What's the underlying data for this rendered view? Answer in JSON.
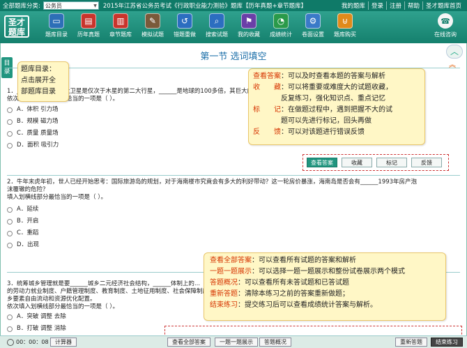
{
  "topbar": {
    "category_label": "全部题库分类:",
    "category_value": "公务员",
    "exam_title": "2015年江苏省公务员考试《行政职业能力测验》题库【历年真题+章节题库】",
    "links": [
      "我的题库",
      "登录",
      "注册",
      "帮助",
      "圣才题库首页"
    ]
  },
  "logo": {
    "line1": "圣才",
    "line2": "题库"
  },
  "tools": [
    {
      "label": "题库目录",
      "icon": "monitor-icon",
      "color": "#2d6fb7"
    },
    {
      "label": "历年真题",
      "icon": "document-icon",
      "color": "#c9342c"
    },
    {
      "label": "章节题库",
      "icon": "book-icon",
      "color": "#c9342c"
    },
    {
      "label": "模拟试题",
      "icon": "pencil-icon",
      "color": "#7a5a3a"
    },
    {
      "label": "错题重做",
      "icon": "undo-icon",
      "color": "#2c6ec0"
    },
    {
      "label": "搜索试题",
      "icon": "search-icon",
      "color": "#2c6ec0"
    },
    {
      "label": "我的收藏",
      "icon": "bookmark-icon",
      "color": "#6a3fa8"
    },
    {
      "label": "成绩统计",
      "icon": "pie-chart-icon",
      "color": "#2a9a4a"
    },
    {
      "label": "卷面设置",
      "icon": "gear-icon",
      "color": "#3a7ac8"
    },
    {
      "label": "题库购买",
      "icon": "cart-icon",
      "color": "#e08a1a"
    }
  ],
  "online": {
    "label": "在线咨询",
    "icon": "chat-icon"
  },
  "side_tab": {
    "label": "目录"
  },
  "section_title": "第一节  选词填空",
  "questions": [
    {
      "text": "1．______木星的第二大卫星是仅次于木星的第二大行星，______是地球的100多倍，其巨大的磁场...",
      "text2": "依次填入划横线部分最恰当的一项是（    ）。",
      "options": [
        "A．体积  引力场",
        "B．规模  磁力场",
        "C．质量  质量场",
        "D．面积  吸引力"
      ]
    },
    {
      "text": "2．牛年末虎年初，世人已经开始思考：国际旅游岛的规划，对于海南楼市究竟会有多大的利好带动？这一轮房价暴涨，海南岛是否会有______1993年房产泡",
      "text2": "沫覆辙的危险？",
      "text3": "填入划横线部分最恰当的一项是（    ）。",
      "options": [
        "A．延续",
        "B．开启",
        "C．重蹈",
        "D．出现"
      ]
    },
    {
      "text": "3．统筹城乡管理就是要______城乡二元经济社会结构，______体制上的...",
      "text2": "的劳动力就业制度、户籍管理制度、教育制度、土地征用制度、社会保障制度等，",
      "text3": "乡要素自由流动和资源优化配置。",
      "text4": "依次填入划横线部分最恰当的一项是（    ）。",
      "options": [
        "A．突破  调整  去除",
        "B．打破  调整  消除"
      ]
    }
  ],
  "question_actions": [
    "查看答案",
    "收藏",
    "标记",
    "反馈"
  ],
  "callout_catalog": {
    "line1": "题库目录：",
    "line2": "点击展开全",
    "line3": "部题库目录"
  },
  "callout_actions": [
    {
      "term": "查看答案",
      "desc": "：可以及时查看本题的答案与解析"
    },
    {
      "term": "收　　藏",
      "desc": "：可以将重要或难度大的试题收藏，"
    },
    {
      "term": "",
      "desc": "　　　　反复练习，强化知识点、重点记忆"
    },
    {
      "term": "标　　记",
      "desc": "：在做题过程中，遇到把握不大的试"
    },
    {
      "term": "",
      "desc": "　　　　题可以先进行标记，回头再做"
    },
    {
      "term": "反　　馈",
      "desc": "：可以对该题进行错误反馈"
    }
  ],
  "callout_bottom": [
    {
      "term": "查看全部答案",
      "desc": "：可以查看所有试题的答案和解析"
    },
    {
      "term": "一题一题展示",
      "desc": "：可以选择一题一题展示和整份试卷展示两个模式"
    },
    {
      "term": "答题概况",
      "desc": "：可以查看所有未答试题和已答试题"
    },
    {
      "term": "重新答题",
      "desc": "：清除本练习之前的答案重新做题；"
    },
    {
      "term": "结束练习",
      "desc": "：提交练习后可以查看成绩统计答案与解析。"
    }
  ],
  "bottombar": {
    "timer": "00：00：08",
    "calculator": "计算器",
    "view_all": "查看全部答案",
    "one_by_one": "一题一题展示",
    "overview": "答题概况",
    "restart": "重新答题",
    "finish": "结束练习"
  }
}
